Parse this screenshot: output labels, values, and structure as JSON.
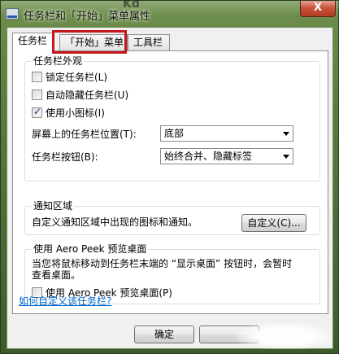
{
  "window": {
    "title": "任务栏和「开始」菜单属性",
    "background_text": "Kd",
    "close_label": "X"
  },
  "tabs": [
    {
      "label": "任务栏",
      "active": true
    },
    {
      "label": "「开始」菜单",
      "active": false,
      "highlighted": true
    },
    {
      "label": "工具栏",
      "active": false
    }
  ],
  "appearance": {
    "legend": "任务栏外观",
    "lock_taskbar": {
      "label": "锁定任务栏(L)",
      "checked": false
    },
    "auto_hide": {
      "label": "自动隐藏任务栏(U)",
      "checked": false
    },
    "small_icons": {
      "label": "使用小图标(I)",
      "checked": true
    },
    "location_label": "屏幕上的任务栏位置(T):",
    "location_value": "底部",
    "buttons_label": "任务栏按钮(B):",
    "buttons_value": "始终合并、隐藏标签"
  },
  "notification": {
    "legend": "通知区域",
    "description": "自定义通知区域中出现的图标和通知。",
    "customize_label": "自定义(C)..."
  },
  "aero_peek": {
    "legend": "使用 Aero Peek 预览桌面",
    "description_line1": "当您将鼠标移动到任务栏末端的 “显示桌面” 按钮时，会暂时",
    "description_line2": "查看桌面。",
    "checkbox": {
      "label": "使用 Aero Peek 预览桌面(P)",
      "checked": false
    }
  },
  "help_link": "如何自定义该任务栏?",
  "footer": {
    "ok_label": "确定"
  },
  "colors": {
    "highlight": "#c8161d",
    "link": "#0066cc"
  }
}
